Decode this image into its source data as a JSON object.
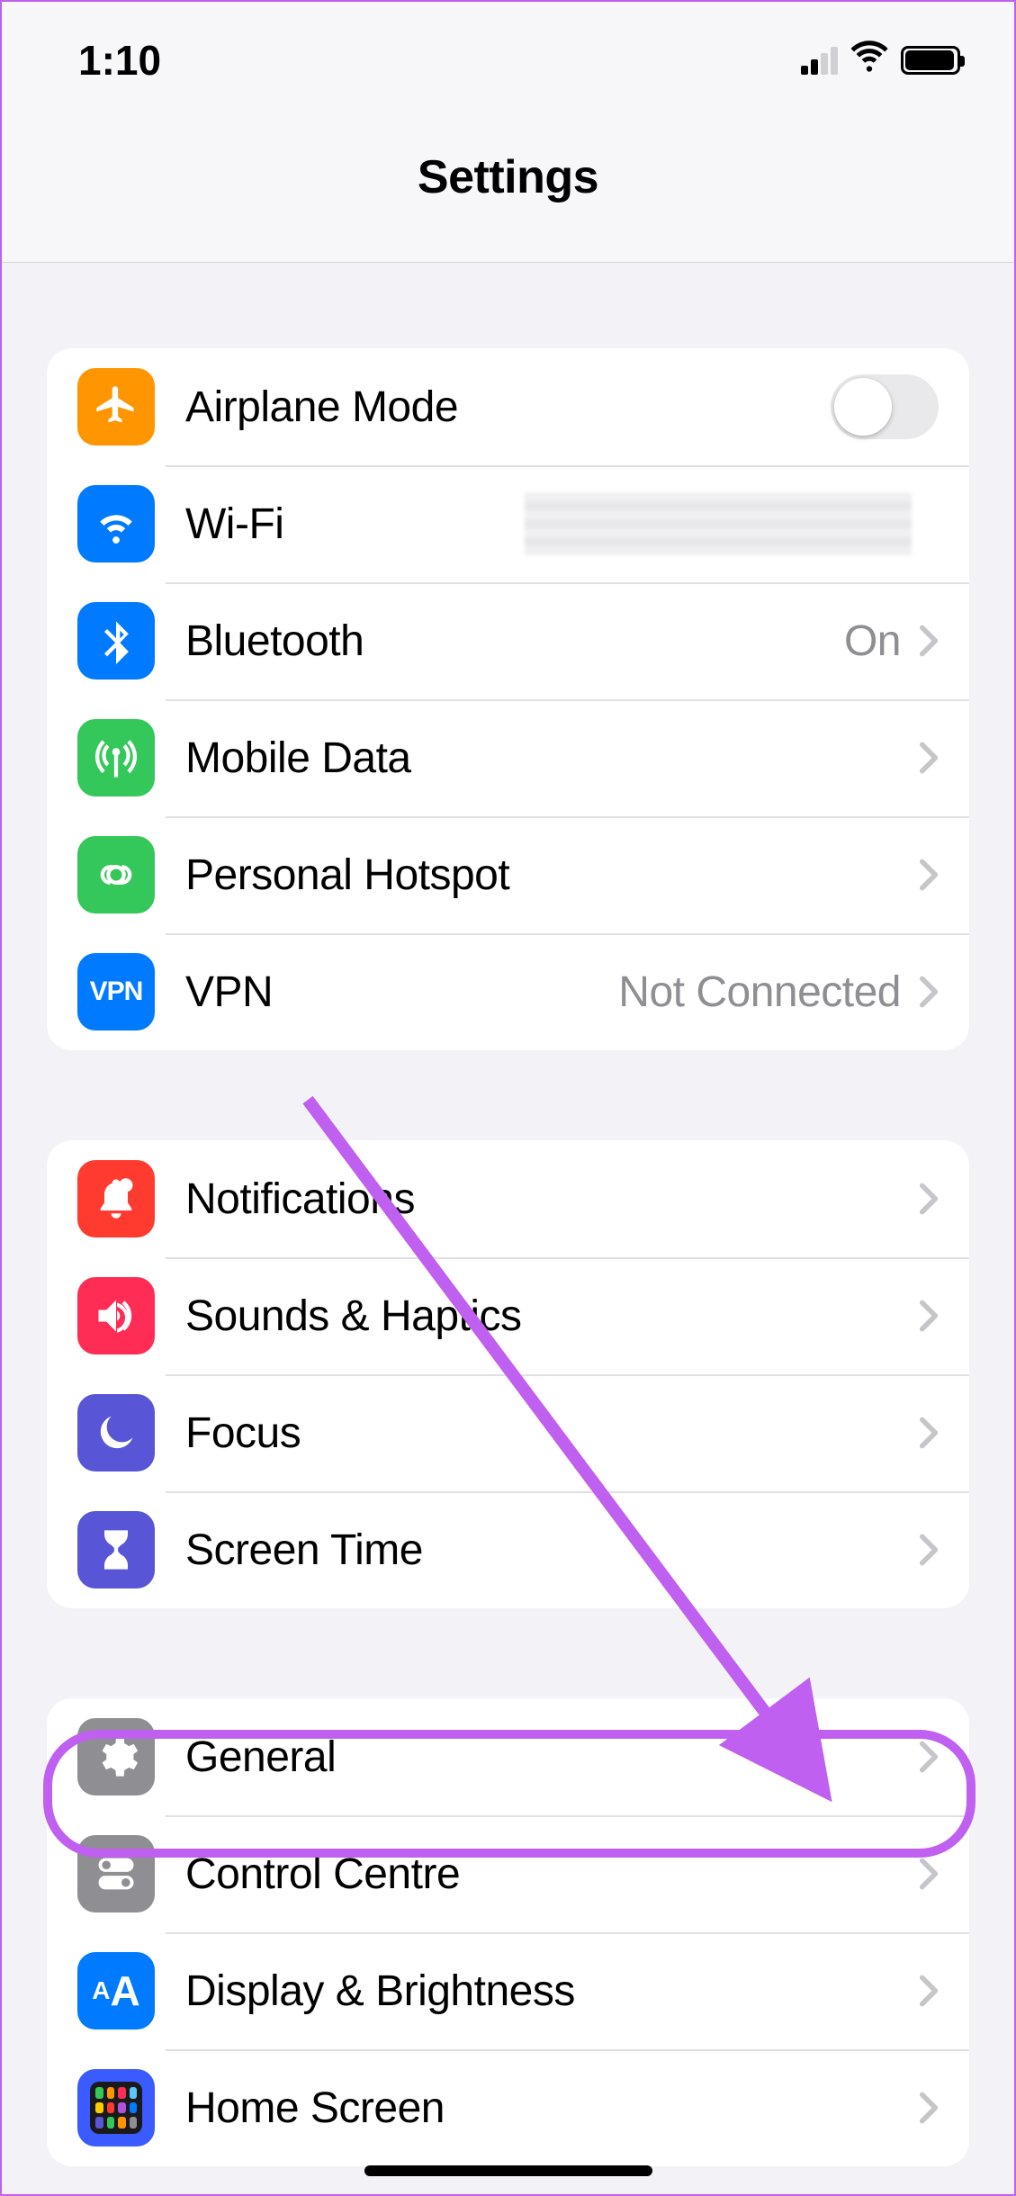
{
  "status": {
    "time": "1:10"
  },
  "header": {
    "title": "Settings"
  },
  "groups": {
    "network": {
      "airplane": {
        "label": "Airplane Mode"
      },
      "wifi": {
        "label": "Wi-Fi"
      },
      "bluetooth": {
        "label": "Bluetooth",
        "value": "On"
      },
      "mobile": {
        "label": "Mobile Data"
      },
      "hotspot": {
        "label": "Personal Hotspot"
      },
      "vpn": {
        "label": "VPN",
        "value": "Not Connected"
      }
    },
    "alerts": {
      "notifications": {
        "label": "Notifications"
      },
      "sounds": {
        "label": "Sounds & Haptics"
      },
      "focus": {
        "label": "Focus"
      },
      "screentime": {
        "label": "Screen Time"
      }
    },
    "system": {
      "general": {
        "label": "General"
      },
      "control": {
        "label": "Control Centre"
      },
      "display": {
        "label": "Display & Brightness"
      },
      "homescreen": {
        "label": "Home Screen"
      }
    }
  },
  "annotation": {
    "highlighted_item": "general",
    "accent_color": "#c060f0"
  }
}
